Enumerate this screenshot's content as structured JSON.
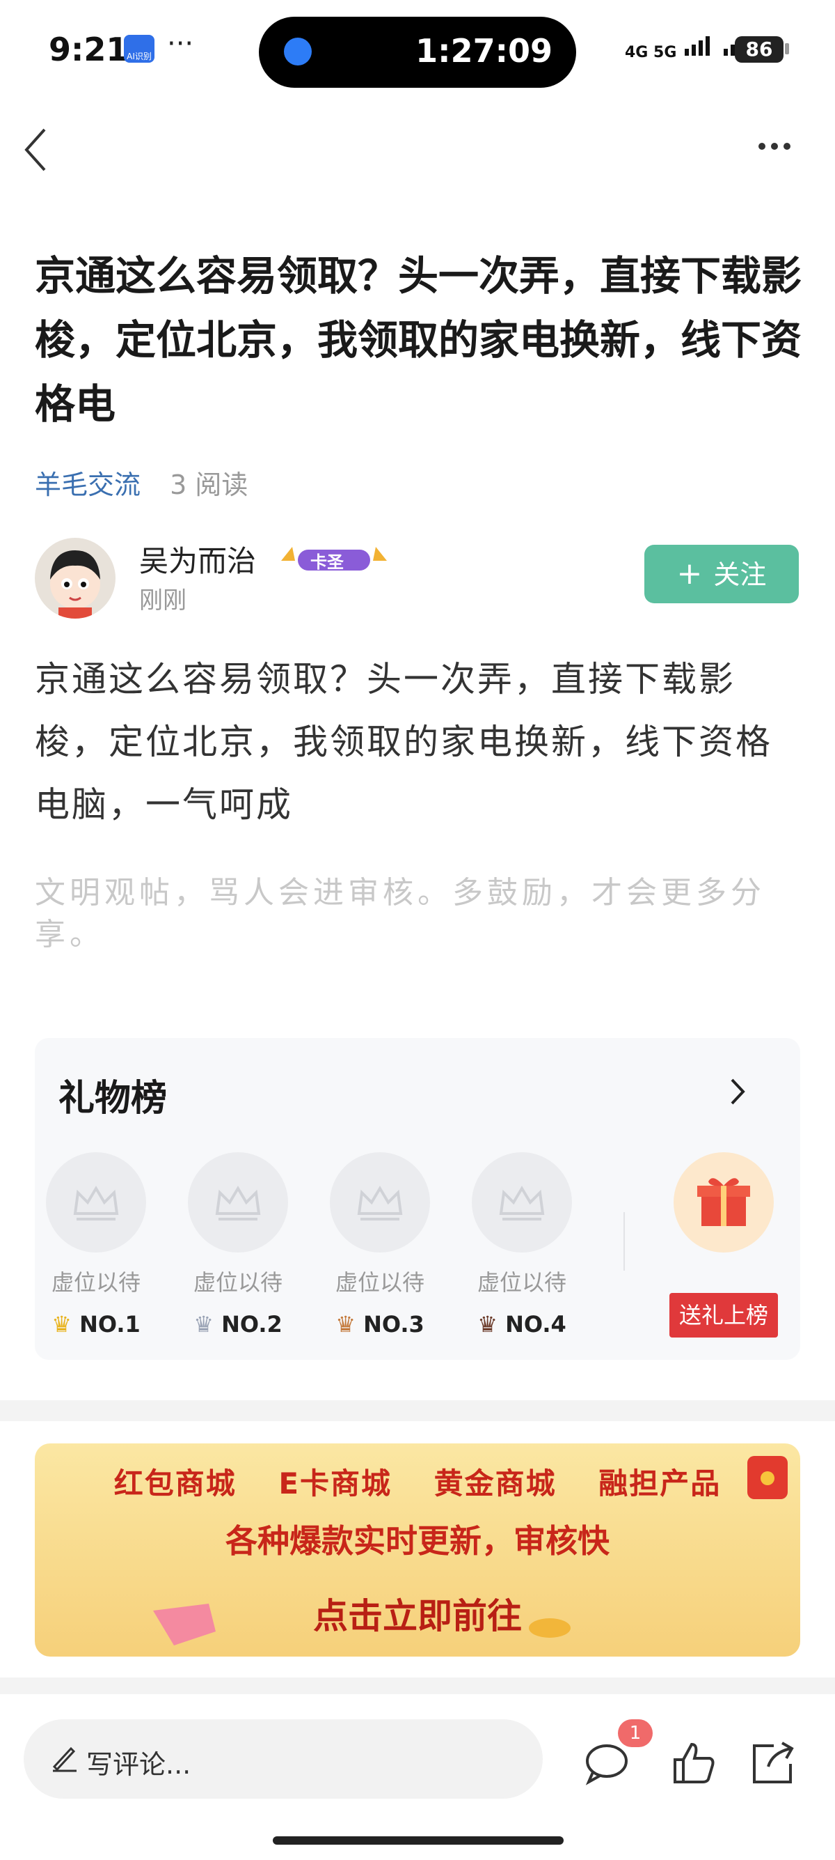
{
  "status_bar": {
    "time": "9:21",
    "app_badge": "AI识别",
    "more": "···",
    "timer": "1:27:09",
    "network": "4G 5G",
    "battery": "86"
  },
  "nav": {
    "back_icon": "chevron-left-icon",
    "more_icon": "more-dots-icon"
  },
  "post": {
    "title": "京通这么容易领取？头一次弄，直接下载影梭，定位北京，我领取的家电换新，线下资格电",
    "category": "羊毛交流",
    "reads": "3 阅读",
    "author": "吴为而治",
    "author_badge": "卡圣",
    "time": "刚刚",
    "follow_label": "关注",
    "body": "京通这么容易领取？头一次弄，直接下载影梭，定位北京，我领取的家电换新，线下资格电脑，一气呵成",
    "hint": "文明观帖，骂人会进审核。多鼓励，才会更多分享。"
  },
  "gift_board": {
    "title": "礼物榜",
    "slots": [
      {
        "wait": "虚位以待",
        "rank": "NO.1"
      },
      {
        "wait": "虚位以待",
        "rank": "NO.2"
      },
      {
        "wait": "虚位以待",
        "rank": "NO.3"
      },
      {
        "wait": "虚位以待",
        "rank": "NO.4"
      }
    ],
    "send_label": "送礼上榜"
  },
  "banner": {
    "items": [
      "红包商城",
      "E卡商城",
      "黄金商城",
      "融担产品"
    ],
    "line2": "各种爆款实时更新，审核快",
    "line3": "点击立即前往"
  },
  "bottom_bar": {
    "comment_placeholder": "写评论...",
    "comment_count": "1"
  },
  "colors": {
    "follow": "#5bbf9f",
    "category": "#3a6fb0",
    "send": "#e0393b",
    "banner": "#f6d07a"
  }
}
